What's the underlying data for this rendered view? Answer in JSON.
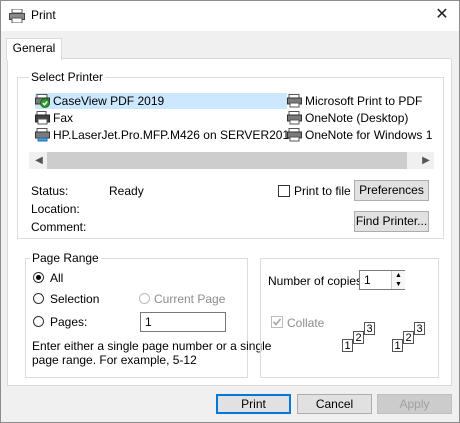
{
  "window": {
    "title": "Print"
  },
  "tabs": [
    {
      "label": "General"
    }
  ],
  "select_printer": {
    "legend": "Select Printer",
    "printers": [
      {
        "name": "CaseView PDF 2019",
        "icon": "printer-default-icon",
        "selected": true
      },
      {
        "name": "Fax",
        "icon": "fax-icon"
      },
      {
        "name": "HP.LaserJet.Pro.MFP.M426 on SERVER2016",
        "icon": "network-printer-icon"
      },
      {
        "name": "Microsoft Print to PDF",
        "icon": "printer-icon"
      },
      {
        "name": "OneNote (Desktop)",
        "icon": "printer-icon"
      },
      {
        "name": "OneNote for Windows 1",
        "icon": "printer-icon"
      }
    ],
    "status_label": "Status:",
    "status_value": "Ready",
    "location_label": "Location:",
    "comment_label": "Comment:",
    "print_to_file_label": "Print to file",
    "preferences_label": "Preferences",
    "find_printer_label": "Find Printer..."
  },
  "page_range": {
    "legend": "Page Range",
    "all_label": "All",
    "selection_label": "Selection",
    "current_page_label": "Current Page",
    "pages_label": "Pages:",
    "pages_value": "1",
    "help_line1": "Enter either a single page number or a single",
    "help_line2": "page range.  For example, 5-12"
  },
  "copies": {
    "number_label": "Number of copies:",
    "number_value": "1",
    "collate_label": "Collate",
    "collate_page_digits": [
      "1",
      "2",
      "3"
    ]
  },
  "footer": {
    "print_label": "Print",
    "cancel_label": "Cancel",
    "apply_label": "Apply"
  },
  "colors": {
    "selection": "#cce8ff",
    "accent": "#0078d7"
  }
}
